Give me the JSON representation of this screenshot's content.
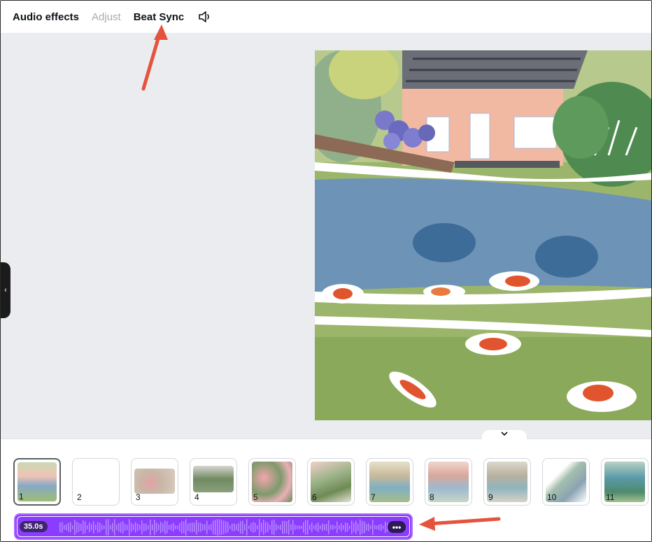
{
  "toolbar": {
    "audio_effects": "Audio effects",
    "adjust": "Adjust",
    "beat_sync": "Beat Sync",
    "volume_icon": "speaker-icon"
  },
  "canvas": {
    "collapse_handle_icon": "chevron-left-icon",
    "artwork_description_icon": "koi-pond-artwork"
  },
  "timeline": {
    "collapse_icon": "chevron-down-icon",
    "pages": [
      {
        "label": "1",
        "selected": true
      },
      {
        "label": "2"
      },
      {
        "label": "3"
      },
      {
        "label": "4"
      },
      {
        "label": "5"
      },
      {
        "label": "6"
      },
      {
        "label": "7"
      },
      {
        "label": "8"
      },
      {
        "label": "9"
      },
      {
        "label": "10"
      },
      {
        "label": "11"
      }
    ]
  },
  "audio": {
    "duration": "35.0s",
    "more_icon": "more-horizontal-icon"
  },
  "colors": {
    "audio_track": "#8b3dff",
    "annotation_arrow": "#e5533d"
  }
}
